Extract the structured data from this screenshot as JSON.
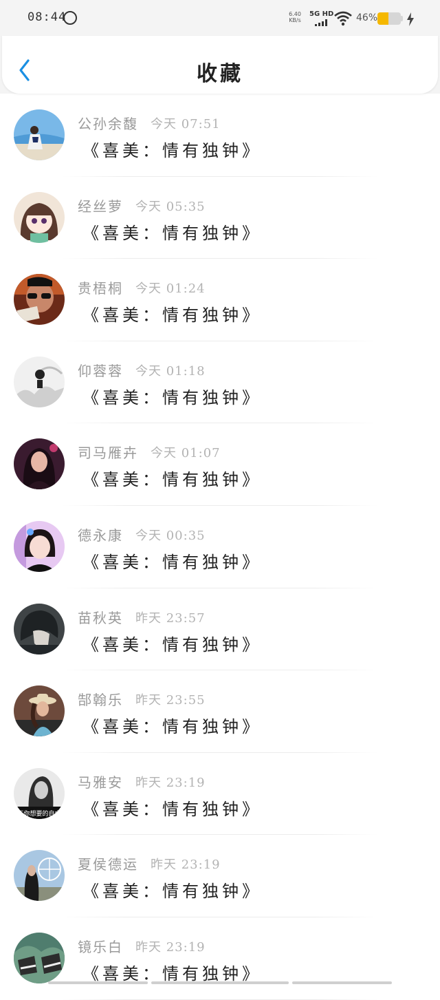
{
  "status_bar": {
    "time": "08:44",
    "net_speed_value": "6.40",
    "net_speed_unit": "KB/s",
    "network": "5G HD",
    "battery_percent": "46%",
    "battery_level": 0.46,
    "battery_color": "#f5b800"
  },
  "header": {
    "title": "收藏",
    "back_icon": "chevron-left-icon",
    "accent_color": "#1a8fe3"
  },
  "items": [
    {
      "name": "公孙余馥",
      "time": "今天 07:51",
      "title": "《喜美：情有独钟》",
      "avatar_icon": "avatar-photo-beach"
    },
    {
      "name": "经丝萝",
      "time": "今天 05:35",
      "title": "《喜美：情有独钟》",
      "avatar_icon": "avatar-anime-girl"
    },
    {
      "name": "贵梧桐",
      "time": "今天 01:24",
      "title": "《喜美：情有独钟》",
      "avatar_icon": "avatar-photo-sunglasses"
    },
    {
      "name": "仰蓉蓉",
      "time": "今天 01:18",
      "title": "《喜美：情有独钟》",
      "avatar_icon": "avatar-ink-painting"
    },
    {
      "name": "司马雁卉",
      "time": "今天 01:07",
      "title": "《喜美：情有独钟》",
      "avatar_icon": "avatar-photo-woman-dark"
    },
    {
      "name": "德永康",
      "time": "今天 00:35",
      "title": "《喜美：情有独钟》",
      "avatar_icon": "avatar-photo-girl-purple"
    },
    {
      "name": "苗秋英",
      "time": "昨天 23:57",
      "title": "《喜美：情有独钟》",
      "avatar_icon": "avatar-anime-boy"
    },
    {
      "name": "郜翰乐",
      "time": "昨天 23:55",
      "title": "《喜美：情有独钟》",
      "avatar_icon": "avatar-photo-hat"
    },
    {
      "name": "马雅安",
      "time": "昨天 23:19",
      "title": "《喜美：情有独钟》",
      "avatar_icon": "avatar-photo-monochrome"
    },
    {
      "name": "夏侯德运",
      "time": "昨天 23:19",
      "title": "《喜美：情有独钟》",
      "avatar_icon": "avatar-photo-ferris-wheel"
    },
    {
      "name": "镜乐白",
      "time": "昨天 23:19",
      "title": "《喜美：情有独钟》",
      "avatar_icon": "avatar-photo-sneakers"
    }
  ],
  "avatar_caption": "不你想要的自由"
}
